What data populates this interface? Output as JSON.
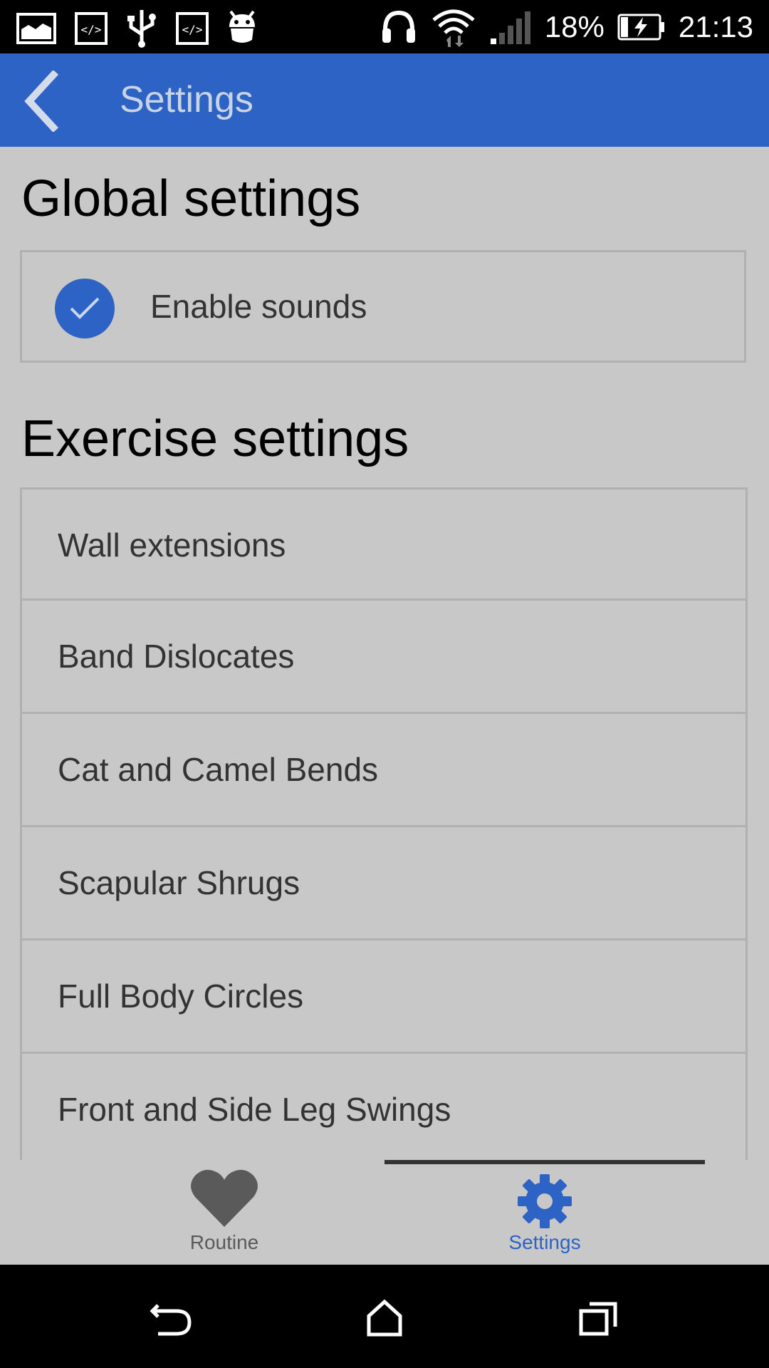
{
  "status_bar": {
    "battery": "18%",
    "time": "21:13"
  },
  "app_bar": {
    "title": "Settings"
  },
  "global_section": {
    "heading": "Global settings",
    "enable_sounds_label": "Enable sounds",
    "enable_sounds_checked": true
  },
  "exercise_section": {
    "heading": "Exercise settings",
    "items": [
      {
        "label": "Wall extensions"
      },
      {
        "label": "Band Dislocates"
      },
      {
        "label": "Cat and Camel Bends"
      },
      {
        "label": "Scapular Shrugs"
      },
      {
        "label": "Full Body Circles"
      },
      {
        "label": "Front and Side Leg Swings"
      }
    ]
  },
  "bottom_nav": {
    "tabs": [
      {
        "label": "Routine",
        "icon": "heart-icon",
        "selected": false
      },
      {
        "label": "Settings",
        "icon": "gear-icon",
        "selected": true
      }
    ]
  },
  "colors": {
    "accent": "#2c63c5",
    "background": "#c8c8c8",
    "inactive": "#5a5a5a"
  }
}
